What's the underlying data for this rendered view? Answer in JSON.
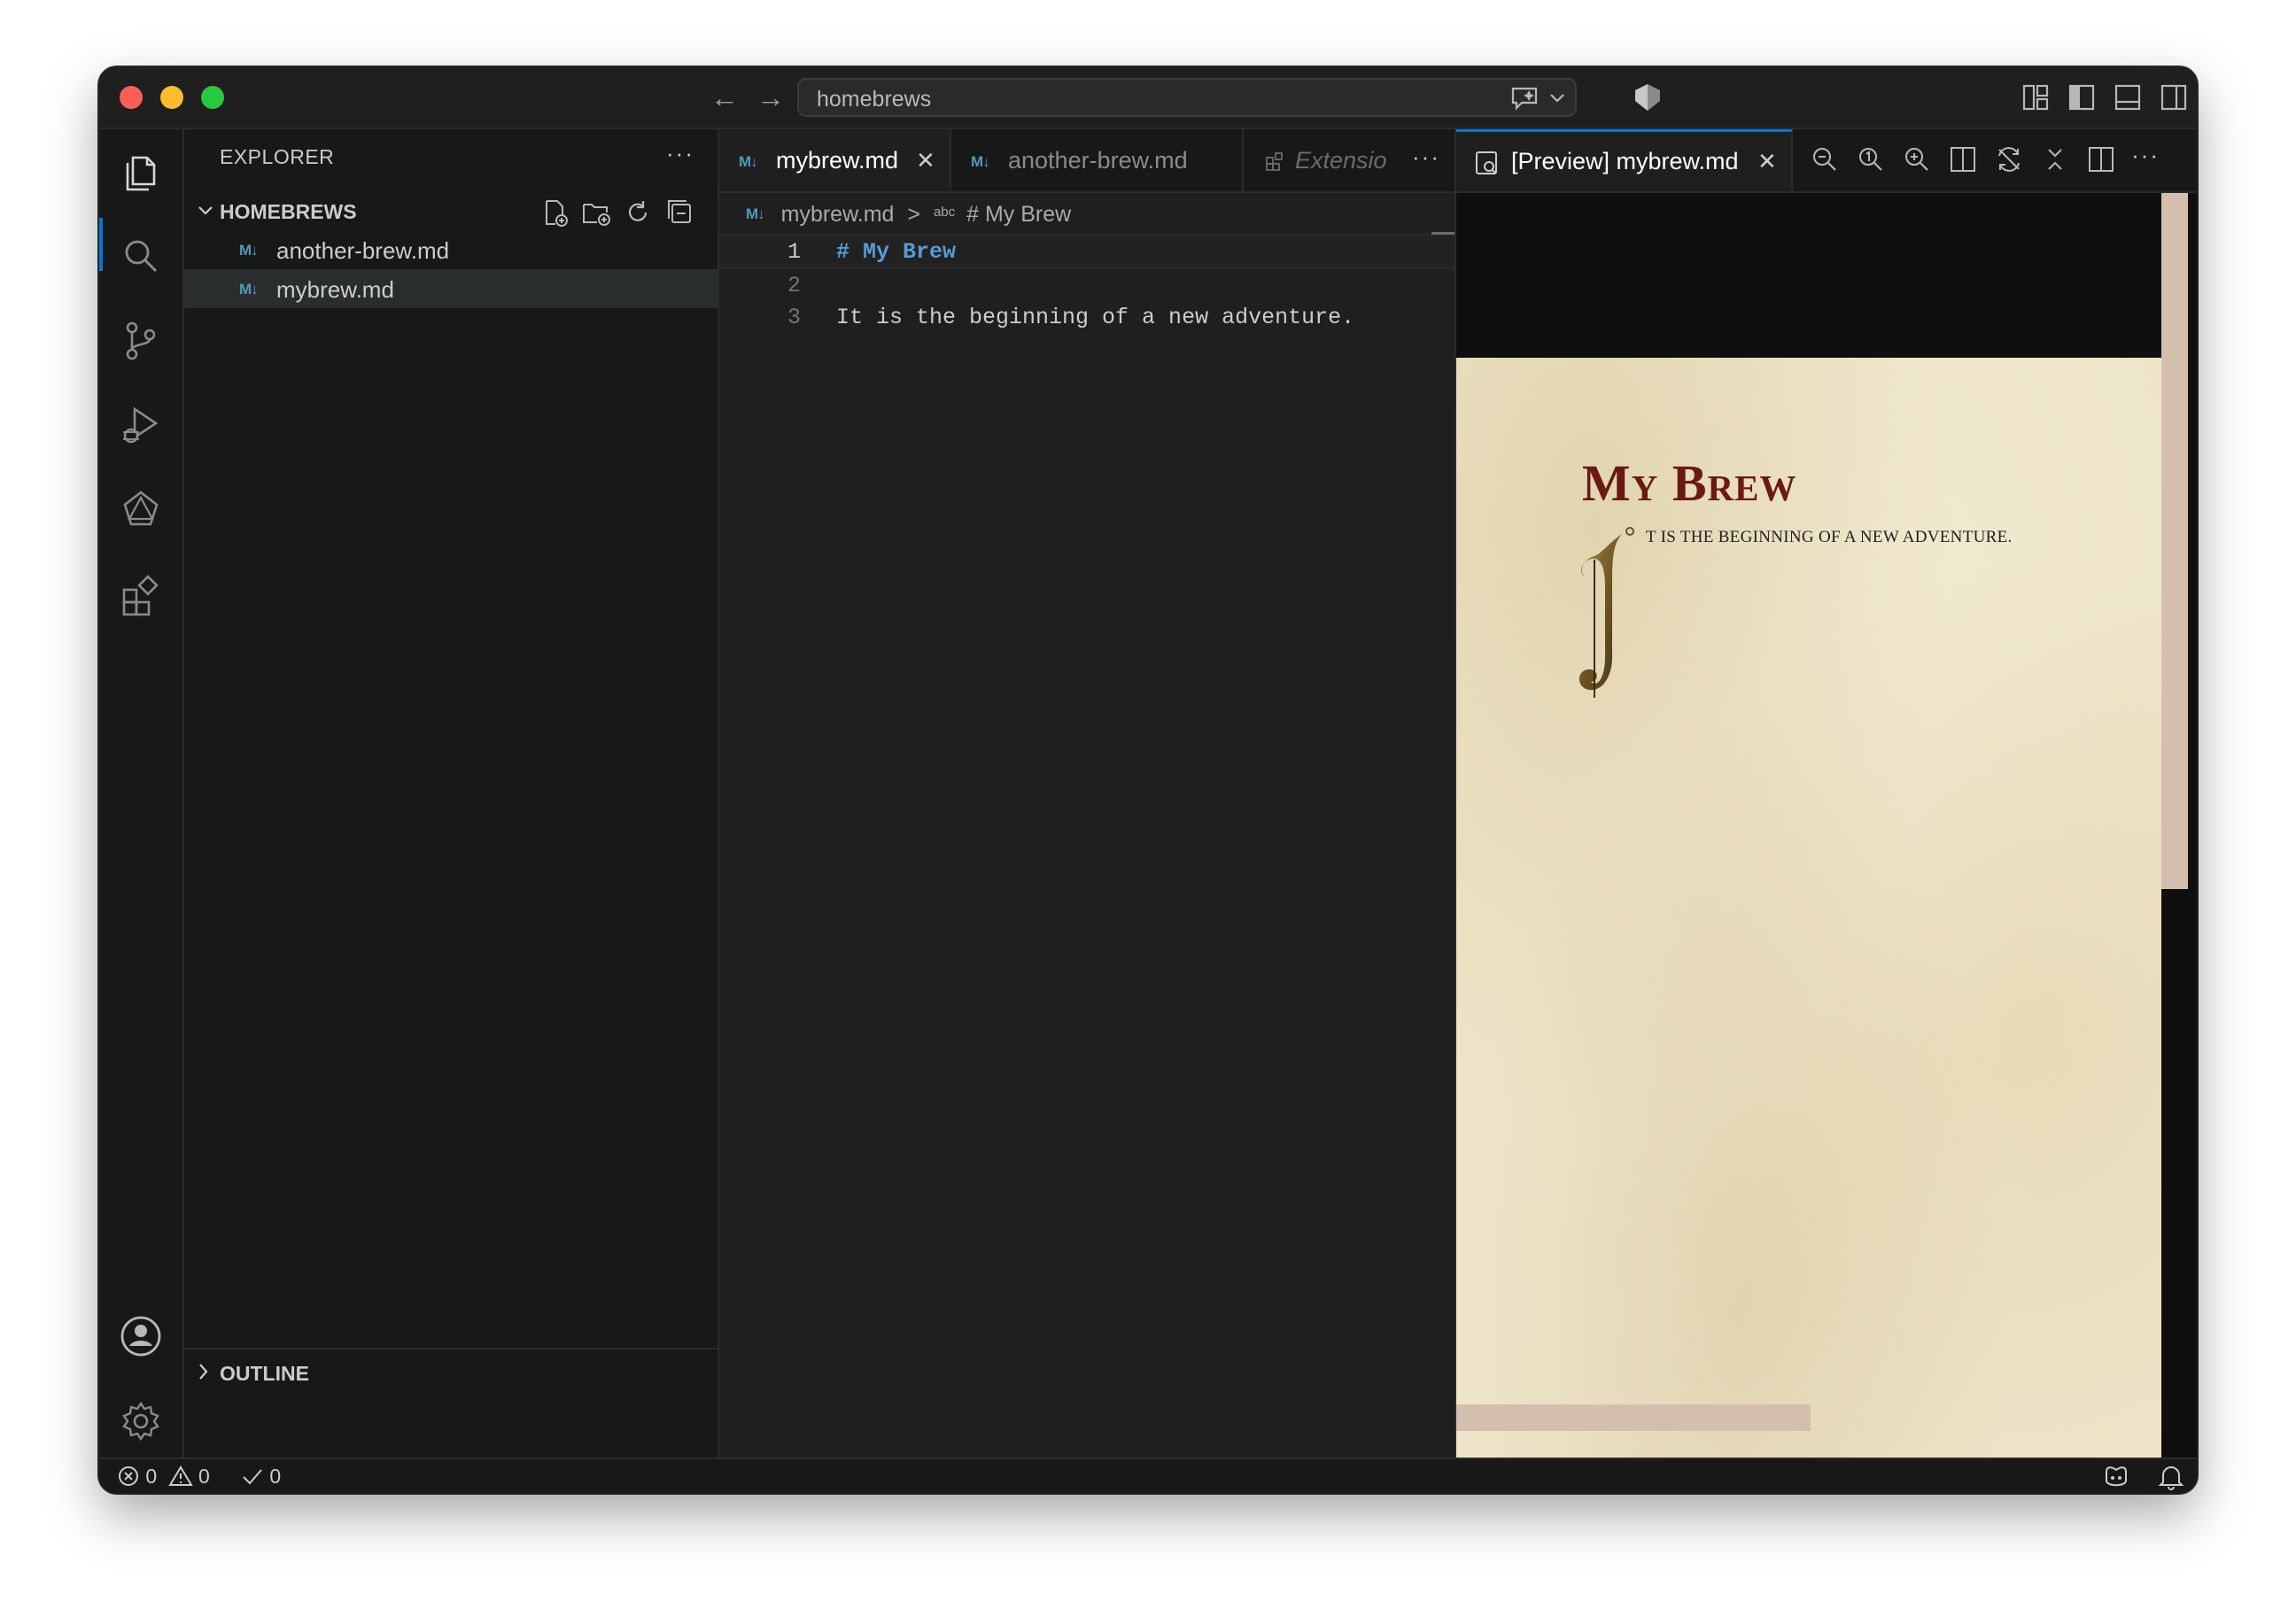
{
  "titlebar": {
    "search_text": "homebrews"
  },
  "explorer": {
    "title": "EXPLORER",
    "more": "···",
    "folder_name": "HOMEBREWS",
    "files": [
      {
        "icon": "M↓",
        "name": "another-brew.md"
      },
      {
        "icon": "M↓",
        "name": "mybrew.md"
      }
    ],
    "outline_label": "OUTLINE"
  },
  "editor": {
    "tabs": [
      {
        "icon": "M↓",
        "label": "mybrew.md"
      },
      {
        "icon": "M↓",
        "label": "another-brew.md"
      },
      {
        "icon": "extensions-icon",
        "label": "Extensio"
      }
    ],
    "tabs_more": "···",
    "breadcrumb": {
      "icon": "M↓",
      "file": "mybrew.md",
      "sep": ">",
      "symbol_icon": "abc",
      "symbol": "# My Brew"
    },
    "lines": [
      {
        "number": "1",
        "text": "# My Brew"
      },
      {
        "number": "2",
        "text": ""
      },
      {
        "number": "3",
        "text": "It is the beginning of a new adventure."
      }
    ]
  },
  "preview": {
    "tab_label": "[Preview] mybrew.md",
    "heading": "My Brew",
    "paragraph": "t is the beginning of a new adventure.",
    "dropcap": "I",
    "more": "···"
  },
  "statusbar": {
    "errors": "0",
    "warnings": "0",
    "checks": "0"
  },
  "colors": {
    "accent": "#0078d4",
    "markdown_icon": "#519aba",
    "heading_red": "#6a1a12",
    "parchment": "#eee5c9"
  }
}
